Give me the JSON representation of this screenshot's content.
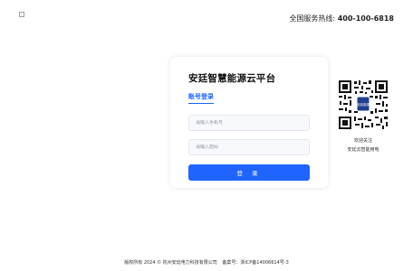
{
  "header": {
    "logo_alt": "",
    "hotline_label": "全国服务热线:",
    "hotline_number": "400-100-6818"
  },
  "login": {
    "title": "安廷智慧能源云平台",
    "tab_label": "账号登录",
    "phone_placeholder": "请输入手机号",
    "password_placeholder": "请输入密码",
    "submit_label": "登 录"
  },
  "qr": {
    "badge_text": "安廷能源",
    "caption_line1": "欢迎关注",
    "caption_line2": "安廷云智能用电"
  },
  "footer": {
    "copyright": "版权所有 2024 © 杭州安廷电力科技有限公司",
    "icp": "备案号：浙ICP备14006614号-3"
  },
  "colors": {
    "accent": "#1f64ff",
    "field_bg": "#f7f9fc",
    "field_border": "#e3e7ee"
  }
}
